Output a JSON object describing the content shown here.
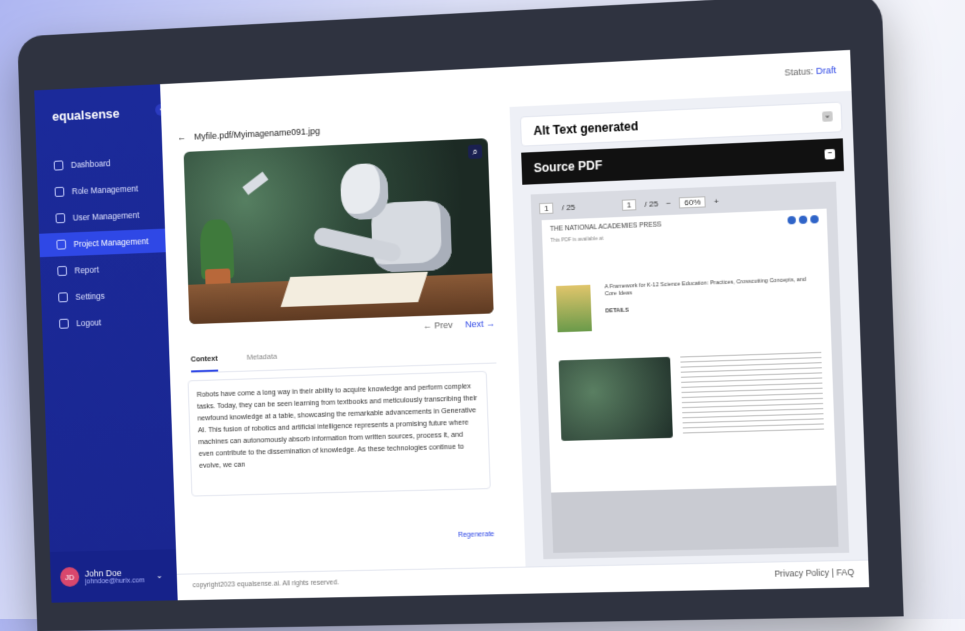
{
  "app": {
    "logo": "equalsense",
    "status_label": "Status:",
    "status_value": "Draft"
  },
  "sidebar": {
    "items": [
      {
        "label": "Dashboard"
      },
      {
        "label": "Role Management"
      },
      {
        "label": "User Management"
      },
      {
        "label": "Project Management",
        "active": true
      },
      {
        "label": "Report"
      },
      {
        "label": "Settings"
      },
      {
        "label": "Logout"
      }
    ],
    "user": {
      "initials": "JD",
      "name": "John Doe",
      "email": "johndoe@hurix.com"
    }
  },
  "left": {
    "file_path": "Myfile.pdf/Myimagename091.jpg",
    "pager": {
      "prev": "← Prev",
      "next": "Next →"
    },
    "tabs": [
      "Context",
      "Metadata"
    ],
    "context_text": "Robots have come a long way in their ability to acquire knowledge and perform complex tasks. Today, they can be seen learning from textbooks and meticulously transcribing their newfound knowledge at a table, showcasing the remarkable advancements in Generative AI. This fusion of robotics and artificial intelligence represents a promising future where machines can autonomously absorb information from written sources, process it, and even contribute to the dissemination of knowledge. As these technologies continue to evolve, we can",
    "regenerate": "Regenerate"
  },
  "right": {
    "alt_text_title": "Alt Text generated",
    "source_title": "Source PDF",
    "viewer": {
      "page": "1",
      "of": "/ 25",
      "page2": "1",
      "of2": "/ 25",
      "zoom": "60%",
      "minus": "−",
      "plus": "+"
    },
    "pdf": {
      "press": "THE NATIONAL ACADEMIES PRESS",
      "available": "This PDF is available at",
      "book_title": "A Framework for K-12 Science Education: Practices, Crosscutting Concepts, and Core Ideas",
      "details": "DETAILS"
    }
  },
  "footer": {
    "copyright": "copyright2023 equalsense.ai. All rights reserved.",
    "links": "Privacy Policy | FAQ"
  }
}
